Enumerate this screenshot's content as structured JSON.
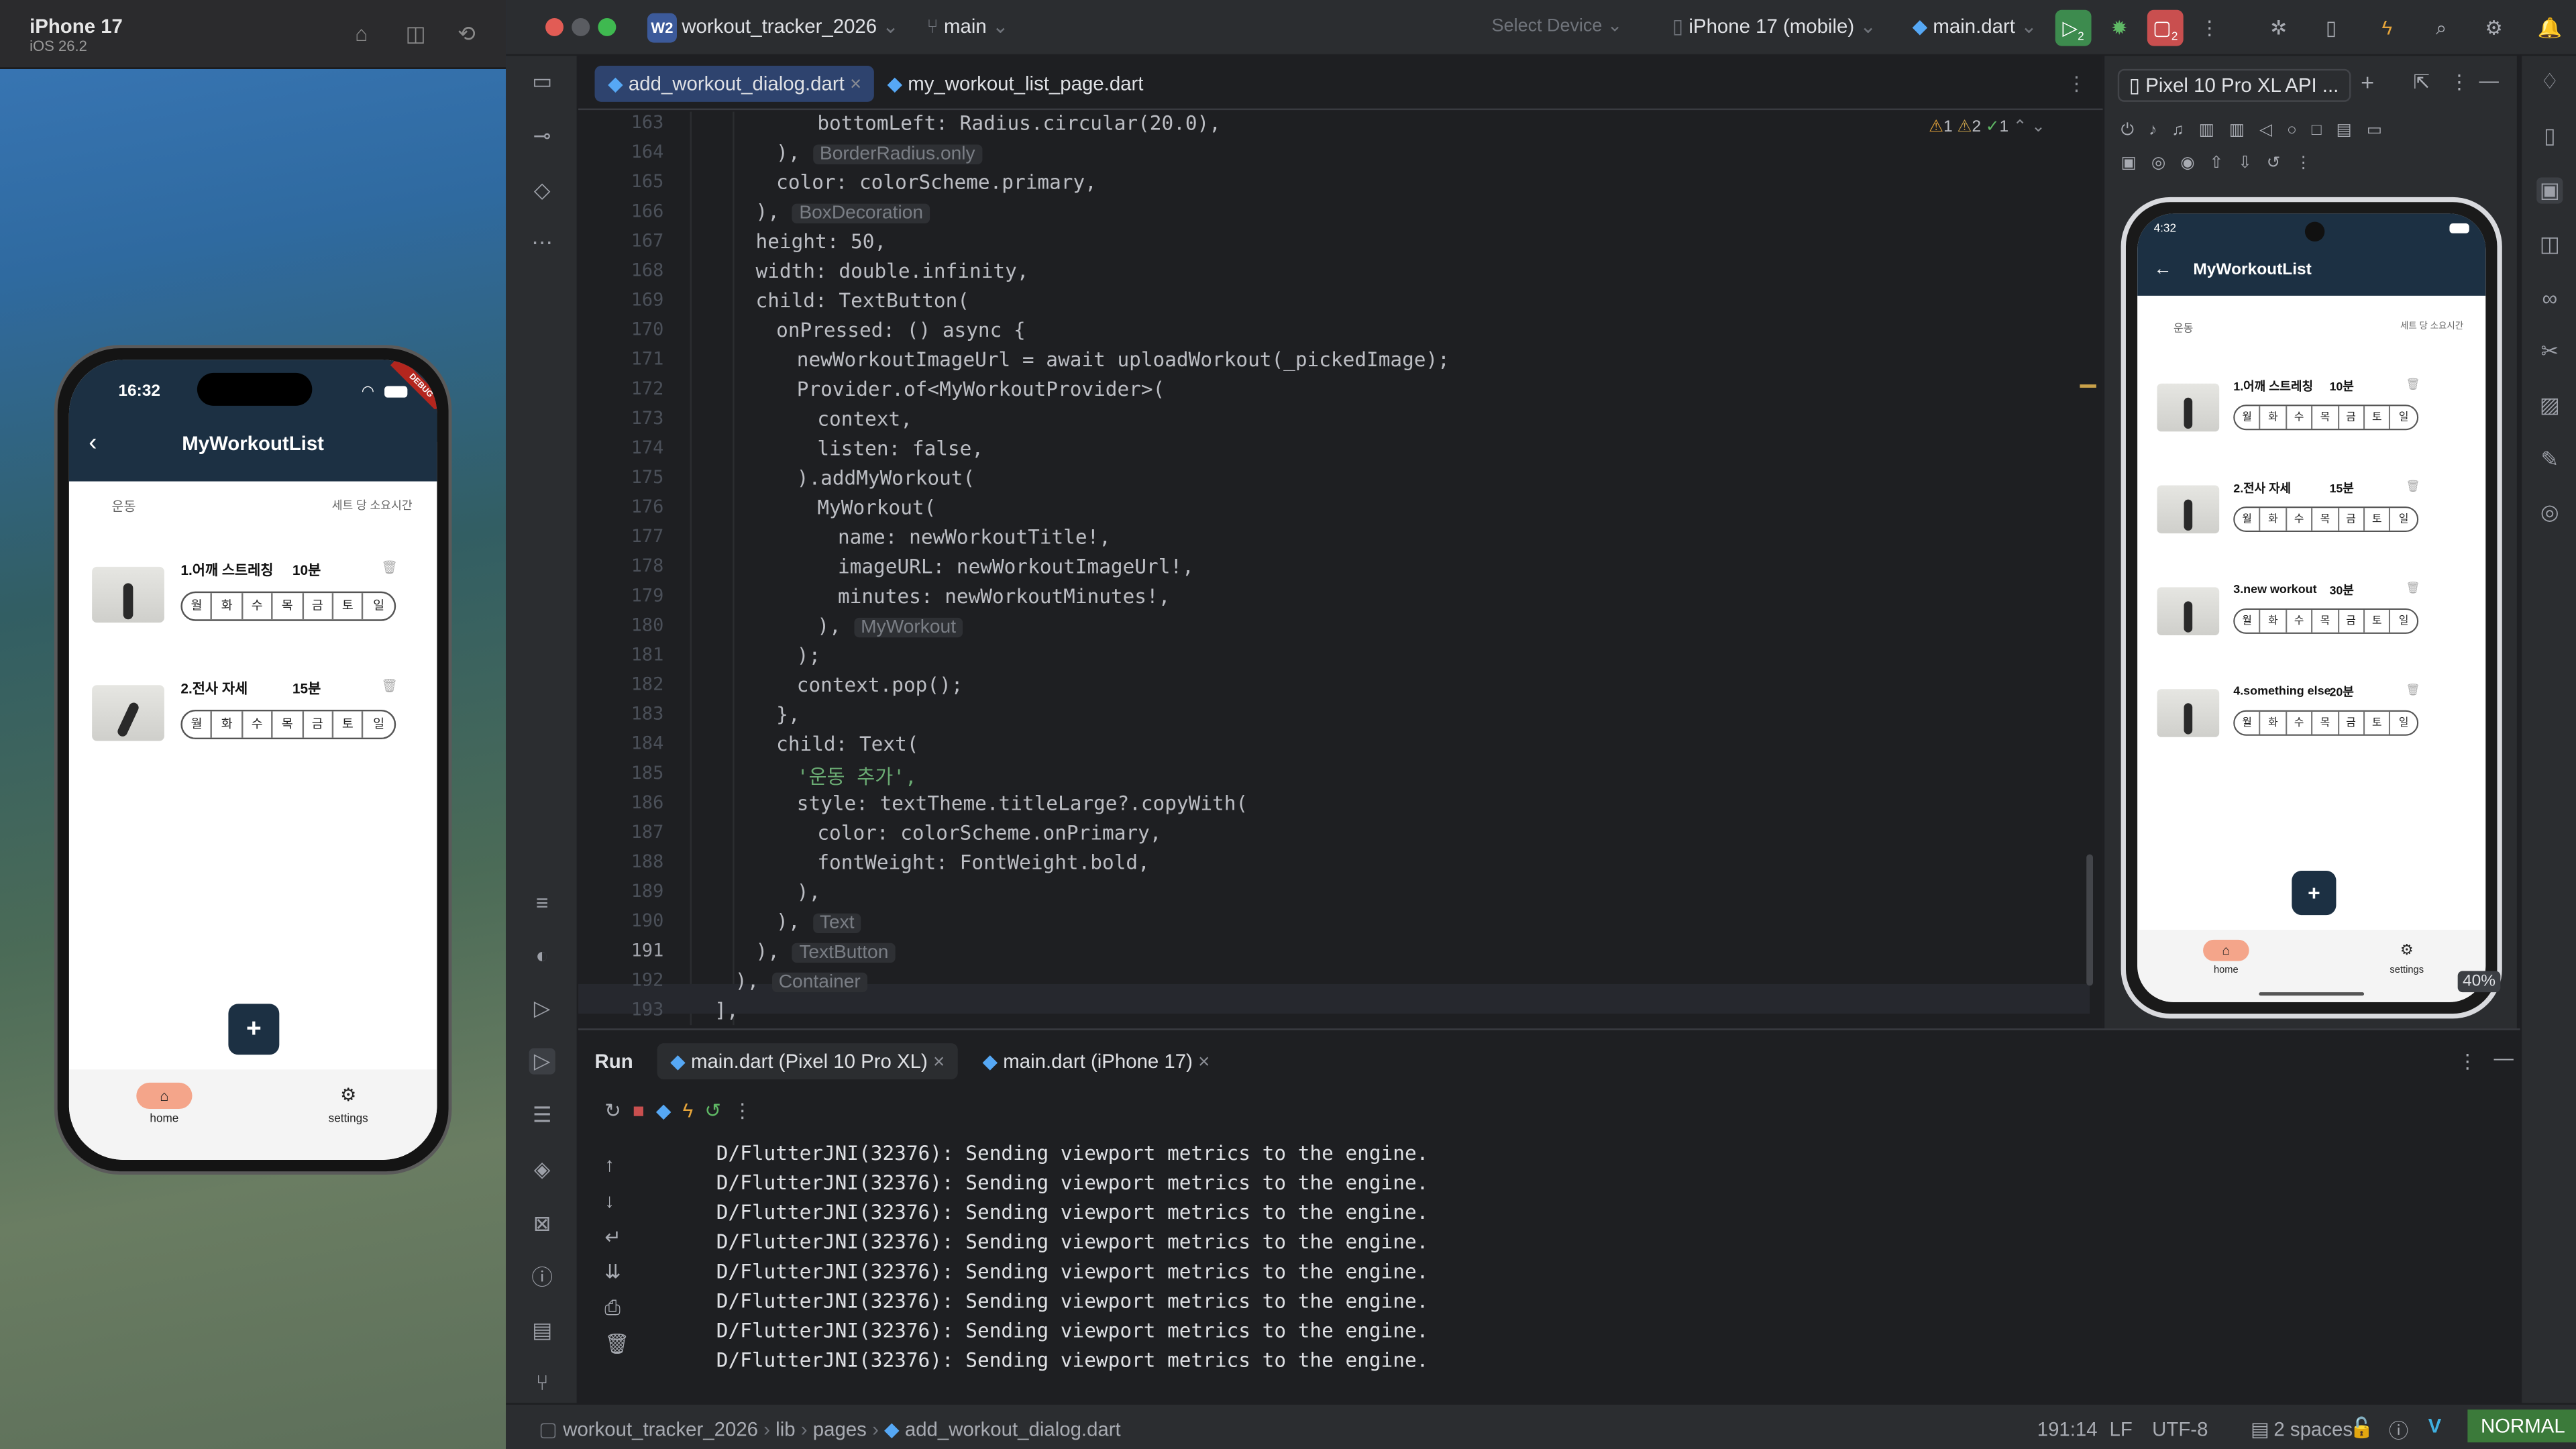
{
  "simulator": {
    "title": "iPhone 17",
    "subtitle": "iOS 26.2",
    "phone": {
      "time": "16:32",
      "debug": "DEBUG",
      "appbar_title": "MyWorkoutList",
      "col_exercise": "운동",
      "col_duration": "세트 당 소요시간",
      "workouts": [
        {
          "name": "1.어깨 스트레칭",
          "minutes": "10분"
        },
        {
          "name": "2.전사 자세",
          "minutes": "15분"
        }
      ],
      "days": [
        "월",
        "화",
        "수",
        "목",
        "금",
        "토",
        "일"
      ],
      "fab": "+",
      "nav": [
        {
          "label": "home"
        },
        {
          "label": "settings"
        }
      ]
    }
  },
  "ide": {
    "project_badge": "W2",
    "project": "workout_tracker_2026",
    "branch": "main",
    "select_device": "Select Device",
    "device": "iPhone 17 (mobile)",
    "run_config": "main.dart",
    "run_badge": "2",
    "tabs": [
      {
        "label": "add_workout_dialog.dart",
        "active": true
      },
      {
        "label": "my_workout_list_page.dart",
        "active": false
      }
    ],
    "inspection": {
      "warnings": "1",
      "weak_warnings": "2",
      "ok": "1"
    },
    "code_lines": [
      {
        "n": "163",
        "t": "bottomLeft: Radius.circular(20.0),"
      },
      {
        "n": "164",
        "t": "),",
        "hint": "BorderRadius.only"
      },
      {
        "n": "165",
        "t": "color: colorScheme.primary,"
      },
      {
        "n": "166",
        "t": "),",
        "hint": "BoxDecoration"
      },
      {
        "n": "167",
        "t": "height: 50,"
      },
      {
        "n": "168",
        "t": "width: double.infinity,"
      },
      {
        "n": "169",
        "t": "child: TextButton("
      },
      {
        "n": "170",
        "t": "onPressed: () async {"
      },
      {
        "n": "171",
        "t": "newWorkoutImageUrl = await uploadWorkout(_pickedImage);"
      },
      {
        "n": "172",
        "t": "Provider.of<MyWorkoutProvider>("
      },
      {
        "n": "173",
        "t": "context,"
      },
      {
        "n": "174",
        "t": "listen: false,"
      },
      {
        "n": "175",
        "t": ").addMyWorkout("
      },
      {
        "n": "176",
        "t": "MyWorkout("
      },
      {
        "n": "177",
        "t": "name: newWorkoutTitle!,"
      },
      {
        "n": "178",
        "t": "imageURL: newWorkoutImageUrl!,"
      },
      {
        "n": "179",
        "t": "minutes: newWorkoutMinutes!,"
      },
      {
        "n": "180",
        "t": "),",
        "hint": "MyWorkout"
      },
      {
        "n": "181",
        "t": ");"
      },
      {
        "n": "182",
        "t": "context.pop();"
      },
      {
        "n": "183",
        "t": "},"
      },
      {
        "n": "184",
        "t": "child: Text("
      },
      {
        "n": "185",
        "t": "'운동 추가',"
      },
      {
        "n": "186",
        "t": "style: textTheme.titleLarge?.copyWith("
      },
      {
        "n": "187",
        "t": "color: colorScheme.onPrimary,"
      },
      {
        "n": "188",
        "t": "fontWeight: FontWeight.bold,"
      },
      {
        "n": "189",
        "t": "),"
      },
      {
        "n": "190",
        "t": "),",
        "hint": "Text"
      },
      {
        "n": "191",
        "t": "),",
        "hint": "TextButton"
      },
      {
        "n": "192",
        "t": "),",
        "hint": "Container"
      },
      {
        "n": "193",
        "t": "],"
      }
    ],
    "running_devices": {
      "tab": "Pixel 10 Pro XL API ...",
      "zoom": "40%",
      "phone": {
        "time": "4:32",
        "appbar_title": "MyWorkoutList",
        "col_exercise": "운동",
        "col_duration": "세트 당 소요시간",
        "workouts": [
          {
            "name": "1.어깨 스트레칭",
            "minutes": "10분"
          },
          {
            "name": "2.전사 자세",
            "minutes": "15분"
          },
          {
            "name": "3.new workout",
            "minutes": "30분"
          },
          {
            "name": "4.something else",
            "minutes": "20분"
          }
        ],
        "nav": [
          {
            "label": "home"
          },
          {
            "label": "settings"
          }
        ]
      }
    },
    "run_panel": {
      "title": "Run",
      "tabs": [
        {
          "label": "main.dart (Pixel 10 Pro XL)",
          "active": true
        },
        {
          "label": "main.dart (iPhone 17)",
          "active": false
        }
      ],
      "log": [
        "D/FlutterJNI(32376): Sending viewport metrics to the engine.",
        "D/FlutterJNI(32376): Sending viewport metrics to the engine.",
        "D/FlutterJNI(32376): Sending viewport metrics to the engine.",
        "D/FlutterJNI(32376): Sending viewport metrics to the engine.",
        "D/FlutterJNI(32376): Sending viewport metrics to the engine.",
        "D/FlutterJNI(32376): Sending viewport metrics to the engine.",
        "D/FlutterJNI(32376): Sending viewport metrics to the engine.",
        "D/FlutterJNI(32376): Sending viewport metrics to the engine."
      ]
    },
    "status_bar": {
      "breadcrumb": [
        "workout_tracker_2026",
        "lib",
        "pages",
        "add_workout_dialog.dart"
      ],
      "position": "191:14",
      "line_sep": "LF",
      "encoding": "UTF-8",
      "indent": "2 spaces",
      "vim_mode": "NORMAL"
    }
  },
  "colors": {
    "app_primary": "#1c3043",
    "nav_pill": "#f4a58a",
    "ide_bg": "#1e1f22",
    "ide_panel": "#2b2d30",
    "run_green": "#3d8b4e",
    "debug_red": "#c94f4f",
    "vim_green": "#3b7a3a"
  }
}
